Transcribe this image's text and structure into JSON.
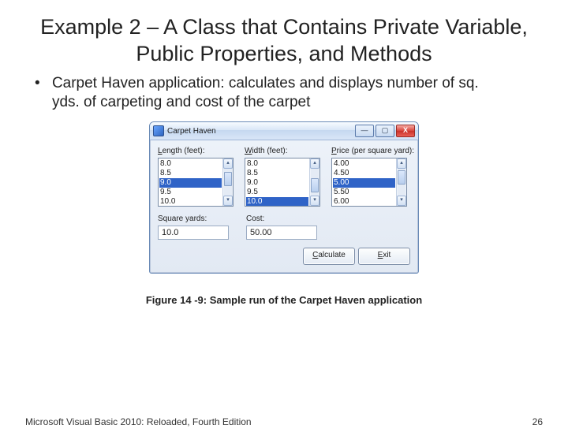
{
  "title": "Example 2 – A Class that Contains Private Variable, Public Properties, and Methods",
  "bullet": "Carpet Haven application: calculates and displays number of sq. yds. of carpeting and cost of the carpet",
  "window": {
    "title": "Carpet Haven",
    "min": "—",
    "max": "▢",
    "close": "X",
    "length_label": "Length (feet):",
    "width_label": "Width (feet):",
    "price_label": "Price (per square yard):",
    "length_items": [
      "8.0",
      "8.5",
      "9.0",
      "9.5",
      "10.0"
    ],
    "length_sel_index": 2,
    "width_items": [
      "8.0",
      "8.5",
      "9.0",
      "9.5",
      "10.0"
    ],
    "width_sel_index": 4,
    "price_items": [
      "4.00",
      "4.50",
      "5.00",
      "5.50",
      "6.00"
    ],
    "price_sel_index": 2,
    "sq_label": "Square yards:",
    "cost_label": "Cost:",
    "sq_value": "10.0",
    "cost_value": "50.00",
    "calc_button": "Calculate",
    "exit_button": "Exit",
    "scroll_up": "▴",
    "scroll_down": "▾"
  },
  "caption": "Figure 14 -9: Sample run of the Carpet Haven application",
  "footer_left": "Microsoft Visual Basic 2010: Reloaded, Fourth Edition",
  "footer_right": "26"
}
